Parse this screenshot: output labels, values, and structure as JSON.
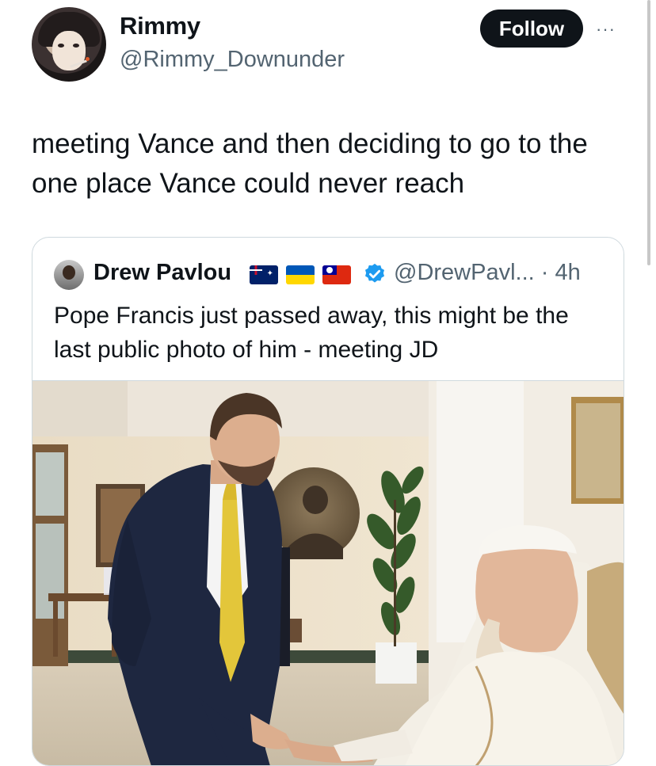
{
  "tweet": {
    "author_name": "Rimmy",
    "author_handle": "@Rimmy_Downunder",
    "follow_label": "Follow",
    "more_label": "···",
    "text": "meeting Vance and then deciding to go to the one place Vance could never reach"
  },
  "quote": {
    "author_name": "Drew Pavlou",
    "flags": [
      "flag-australia-icon",
      "flag-ukraine-icon",
      "flag-taiwan-icon"
    ],
    "verified_icon": "verified-badge-icon",
    "meta": "@DrewPavl... · 4h",
    "text": "Pope Francis just passed away, this might be the last public photo of him - meeting JD"
  },
  "colors": {
    "text": "#0f1419",
    "secondary": "#536471",
    "follow_bg": "#0f1419",
    "verified": "#1d9bf0",
    "border": "#cfd9de"
  }
}
